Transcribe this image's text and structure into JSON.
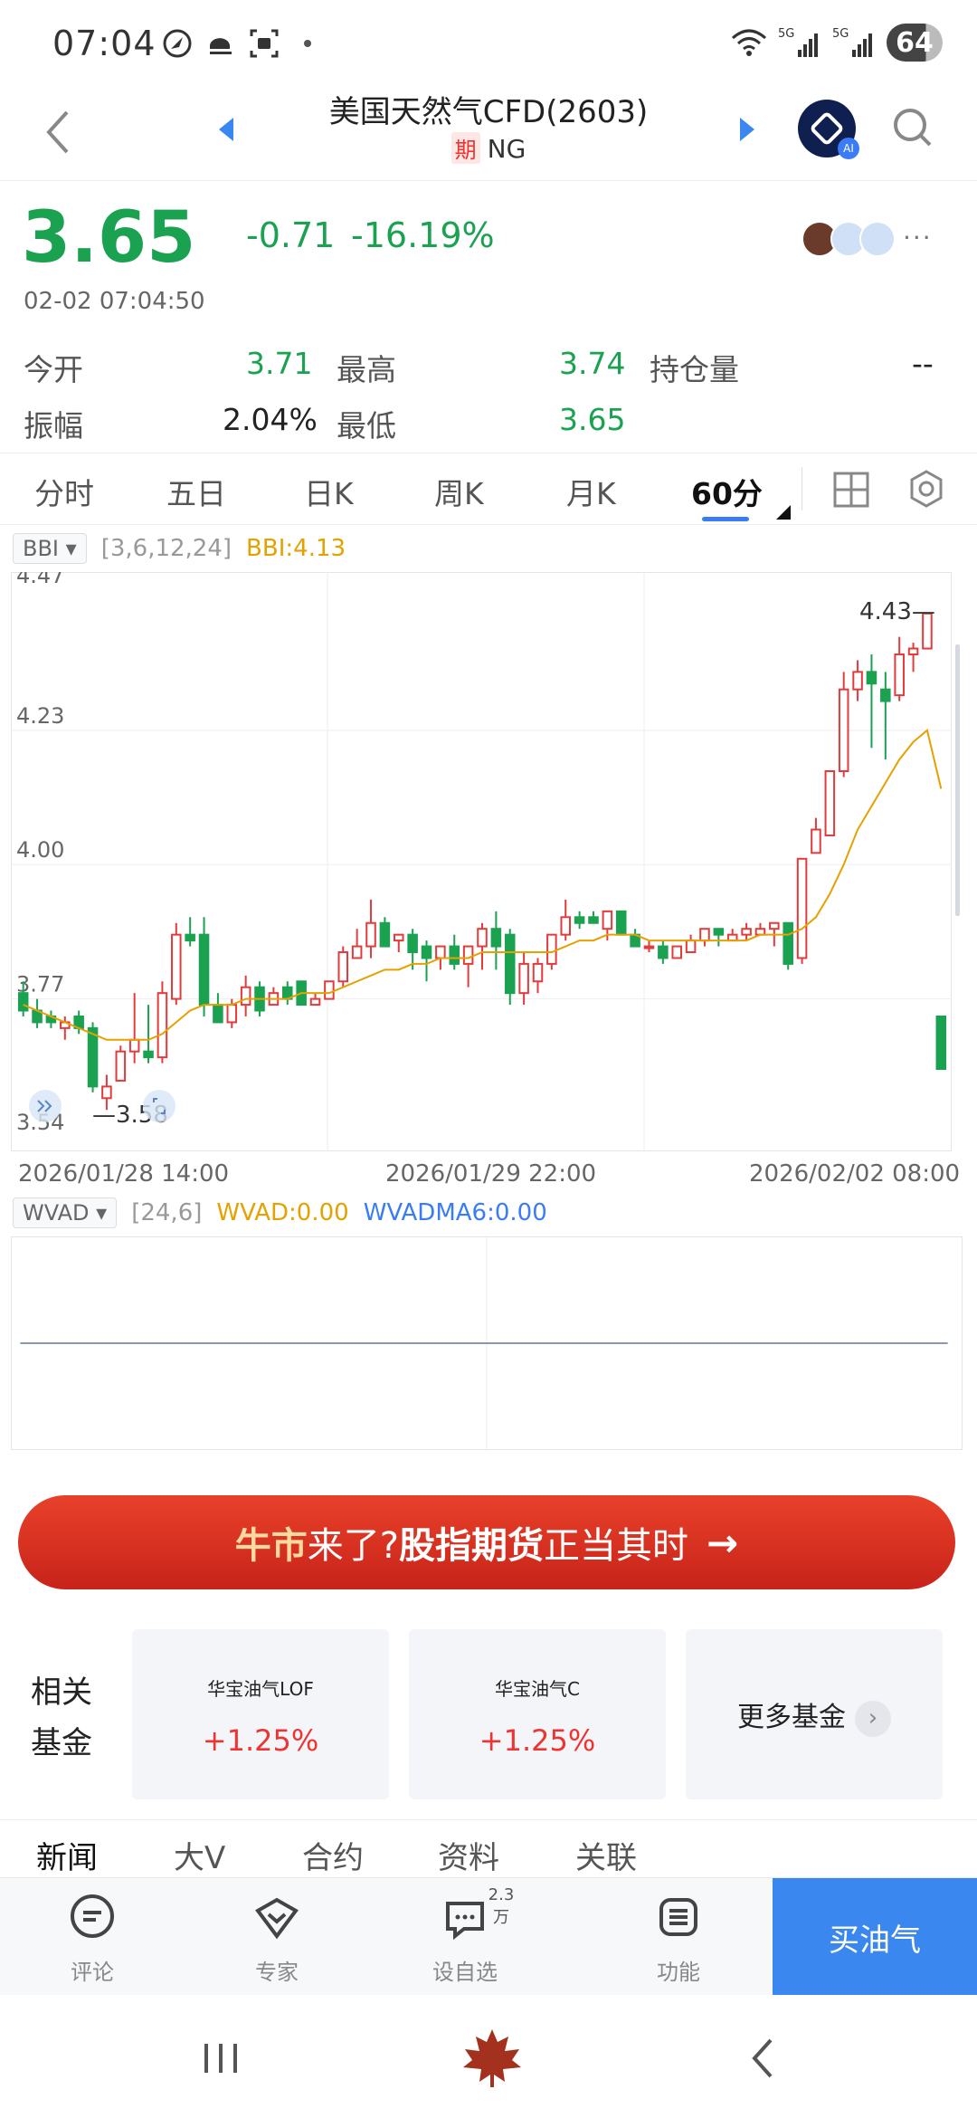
{
  "status_bar": {
    "time": "07:04",
    "battery": "64",
    "network": "5G"
  },
  "header": {
    "title": "美国天然气CFD(2603)",
    "tag": "期",
    "symbol": "NG",
    "ai_badge": "AI"
  },
  "quote": {
    "price": "3.65",
    "change": "-0.71",
    "change_pct": "-16.19%",
    "timestamp": "02-02 07:04:50",
    "more": "···"
  },
  "stats": {
    "open_label": "今开",
    "open": "3.71",
    "high_label": "最高",
    "high": "3.74",
    "oi_label": "持仓量",
    "oi": "--",
    "amp_label": "振幅",
    "amp": "2.04%",
    "low_label": "最低",
    "low": "3.65"
  },
  "period_tabs": [
    "分时",
    "五日",
    "日K",
    "周K",
    "月K",
    "60分"
  ],
  "active_tab": "60分",
  "main_indicator": {
    "name": "BBI",
    "params": "[3,6,12,24]",
    "value": "BBI:4.13"
  },
  "sub_indicator": {
    "name": "WVAD",
    "params": "[24,6]",
    "wvad": "WVAD:0.00",
    "wvadma": "WVADMA6:0.00"
  },
  "chart_data": {
    "type": "candlestick",
    "y_ticks": [
      "4.47",
      "4.23",
      "4.00",
      "3.77",
      "3.54"
    ],
    "ylim": [
      3.54,
      4.47
    ],
    "max_marker": "4.43",
    "min_marker": "3.58",
    "x_labels": [
      "2026/01/28 14:00",
      "2026/01/29 22:00",
      "2026/02/02 08:00"
    ],
    "candles": [
      {
        "o": 3.78,
        "h": 3.8,
        "l": 3.74,
        "c": 3.75
      },
      {
        "o": 3.75,
        "h": 3.77,
        "l": 3.72,
        "c": 3.73
      },
      {
        "o": 3.74,
        "h": 3.75,
        "l": 3.72,
        "c": 3.73
      },
      {
        "o": 3.72,
        "h": 3.74,
        "l": 3.7,
        "c": 3.73
      },
      {
        "o": 3.74,
        "h": 3.75,
        "l": 3.71,
        "c": 3.72
      },
      {
        "o": 3.72,
        "h": 3.73,
        "l": 3.61,
        "c": 3.62
      },
      {
        "o": 3.6,
        "h": 3.64,
        "l": 3.58,
        "c": 3.62
      },
      {
        "o": 3.63,
        "h": 3.69,
        "l": 3.63,
        "c": 3.68
      },
      {
        "o": 3.68,
        "h": 3.78,
        "l": 3.66,
        "c": 3.7
      },
      {
        "o": 3.68,
        "h": 3.76,
        "l": 3.66,
        "c": 3.67
      },
      {
        "o": 3.67,
        "h": 3.8,
        "l": 3.66,
        "c": 3.78
      },
      {
        "o": 3.77,
        "h": 3.9,
        "l": 3.76,
        "c": 3.88
      },
      {
        "o": 3.88,
        "h": 3.91,
        "l": 3.86,
        "c": 3.87
      },
      {
        "o": 3.88,
        "h": 3.91,
        "l": 3.74,
        "c": 3.76
      },
      {
        "o": 3.76,
        "h": 3.78,
        "l": 3.73,
        "c": 3.73
      },
      {
        "o": 3.73,
        "h": 3.77,
        "l": 3.72,
        "c": 3.76
      },
      {
        "o": 3.76,
        "h": 3.81,
        "l": 3.74,
        "c": 3.79
      },
      {
        "o": 3.79,
        "h": 3.8,
        "l": 3.74,
        "c": 3.75
      },
      {
        "o": 3.76,
        "h": 3.79,
        "l": 3.76,
        "c": 3.78
      },
      {
        "o": 3.79,
        "h": 3.8,
        "l": 3.76,
        "c": 3.77
      },
      {
        "o": 3.8,
        "h": 3.8,
        "l": 3.76,
        "c": 3.76
      },
      {
        "o": 3.76,
        "h": 3.78,
        "l": 3.76,
        "c": 3.77
      },
      {
        "o": 3.77,
        "h": 3.8,
        "l": 3.77,
        "c": 3.8
      },
      {
        "o": 3.8,
        "h": 3.86,
        "l": 3.79,
        "c": 3.85
      },
      {
        "o": 3.84,
        "h": 3.89,
        "l": 3.84,
        "c": 3.86
      },
      {
        "o": 3.86,
        "h": 3.94,
        "l": 3.84,
        "c": 3.9
      },
      {
        "o": 3.9,
        "h": 3.91,
        "l": 3.86,
        "c": 3.86
      },
      {
        "o": 3.87,
        "h": 3.88,
        "l": 3.85,
        "c": 3.88
      },
      {
        "o": 3.88,
        "h": 3.89,
        "l": 3.82,
        "c": 3.85
      },
      {
        "o": 3.86,
        "h": 3.87,
        "l": 3.8,
        "c": 3.84
      },
      {
        "o": 3.84,
        "h": 3.86,
        "l": 3.82,
        "c": 3.86
      },
      {
        "o": 3.86,
        "h": 3.88,
        "l": 3.82,
        "c": 3.83
      },
      {
        "o": 3.83,
        "h": 3.86,
        "l": 3.79,
        "c": 3.86
      },
      {
        "o": 3.86,
        "h": 3.9,
        "l": 3.82,
        "c": 3.89
      },
      {
        "o": 3.89,
        "h": 3.92,
        "l": 3.82,
        "c": 3.86
      },
      {
        "o": 3.88,
        "h": 3.89,
        "l": 3.76,
        "c": 3.78
      },
      {
        "o": 3.78,
        "h": 3.85,
        "l": 3.76,
        "c": 3.83
      },
      {
        "o": 3.8,
        "h": 3.84,
        "l": 3.78,
        "c": 3.83
      },
      {
        "o": 3.83,
        "h": 3.88,
        "l": 3.82,
        "c": 3.88
      },
      {
        "o": 3.88,
        "h": 3.94,
        "l": 3.87,
        "c": 3.91
      },
      {
        "o": 3.91,
        "h": 3.92,
        "l": 3.89,
        "c": 3.9
      },
      {
        "o": 3.91,
        "h": 3.92,
        "l": 3.9,
        "c": 3.9
      },
      {
        "o": 3.89,
        "h": 3.92,
        "l": 3.87,
        "c": 3.92
      },
      {
        "o": 3.92,
        "h": 3.92,
        "l": 3.88,
        "c": 3.88
      },
      {
        "o": 3.88,
        "h": 3.89,
        "l": 3.86,
        "c": 3.86
      },
      {
        "o": 3.86,
        "h": 3.87,
        "l": 3.85,
        "c": 3.86
      },
      {
        "o": 3.86,
        "h": 3.87,
        "l": 3.83,
        "c": 3.84
      },
      {
        "o": 3.84,
        "h": 3.86,
        "l": 3.84,
        "c": 3.86
      },
      {
        "o": 3.85,
        "h": 3.88,
        "l": 3.85,
        "c": 3.87
      },
      {
        "o": 3.87,
        "h": 3.89,
        "l": 3.86,
        "c": 3.89
      },
      {
        "o": 3.89,
        "h": 3.89,
        "l": 3.86,
        "c": 3.88
      },
      {
        "o": 3.87,
        "h": 3.89,
        "l": 3.87,
        "c": 3.88
      },
      {
        "o": 3.88,
        "h": 3.9,
        "l": 3.87,
        "c": 3.89
      },
      {
        "o": 3.88,
        "h": 3.9,
        "l": 3.88,
        "c": 3.89
      },
      {
        "o": 3.89,
        "h": 3.9,
        "l": 3.86,
        "c": 3.9
      },
      {
        "o": 3.9,
        "h": 3.9,
        "l": 3.82,
        "c": 3.83
      },
      {
        "o": 3.84,
        "h": 4.01,
        "l": 3.83,
        "c": 4.01
      },
      {
        "o": 4.02,
        "h": 4.08,
        "l": 4.02,
        "c": 4.06
      },
      {
        "o": 4.05,
        "h": 4.16,
        "l": 4.05,
        "c": 4.16
      },
      {
        "o": 4.16,
        "h": 4.33,
        "l": 4.15,
        "c": 4.3
      },
      {
        "o": 4.3,
        "h": 4.35,
        "l": 4.28,
        "c": 4.33
      },
      {
        "o": 4.33,
        "h": 4.36,
        "l": 4.2,
        "c": 4.31
      },
      {
        "o": 4.3,
        "h": 4.33,
        "l": 4.18,
        "c": 4.28
      },
      {
        "o": 4.29,
        "h": 4.39,
        "l": 4.28,
        "c": 4.36
      },
      {
        "o": 4.36,
        "h": 4.38,
        "l": 4.33,
        "c": 4.37
      },
      {
        "o": 4.37,
        "h": 4.43,
        "l": 4.37,
        "c": 4.43
      },
      {
        "o": 3.74,
        "h": 3.74,
        "l": 3.65,
        "c": 3.65
      }
    ],
    "bbi": [
      3.76,
      3.75,
      3.74,
      3.73,
      3.72,
      3.71,
      3.7,
      3.7,
      3.7,
      3.7,
      3.71,
      3.73,
      3.75,
      3.76,
      3.76,
      3.76,
      3.77,
      3.77,
      3.77,
      3.77,
      3.78,
      3.78,
      3.78,
      3.79,
      3.8,
      3.81,
      3.82,
      3.82,
      3.83,
      3.83,
      3.84,
      3.84,
      3.84,
      3.85,
      3.85,
      3.85,
      3.85,
      3.85,
      3.85,
      3.86,
      3.87,
      3.87,
      3.88,
      3.88,
      3.88,
      3.87,
      3.87,
      3.87,
      3.87,
      3.87,
      3.87,
      3.87,
      3.87,
      3.88,
      3.88,
      3.88,
      3.89,
      3.91,
      3.95,
      4.0,
      4.06,
      4.1,
      4.14,
      4.18,
      4.21,
      4.23,
      4.13
    ]
  },
  "promo_banner": {
    "part1": "牛市",
    "part2": "来了? ",
    "part3": "股指期货",
    "part4": "正当其时",
    "arrow": "→"
  },
  "related_funds": {
    "label_line1": "相关",
    "label_line2": "基金",
    "funds": [
      {
        "name": "华宝油气LOF",
        "change": "+1.25%"
      },
      {
        "name": "华宝油气C",
        "change": "+1.25%"
      }
    ],
    "more_label": "更多基金"
  },
  "news_tabs": [
    "新闻",
    "大V",
    "合约",
    "资料",
    "关联"
  ],
  "toolbar": {
    "comment": "评论",
    "expert": "专家",
    "watchlist": "设自选",
    "watchlist_count": "2.3万",
    "features": "功能",
    "buy": "买油气"
  },
  "colors": {
    "up": "#e33b3b",
    "down": "#1aa251",
    "bbi": "#e5a100",
    "accent": "#3a87f0"
  }
}
